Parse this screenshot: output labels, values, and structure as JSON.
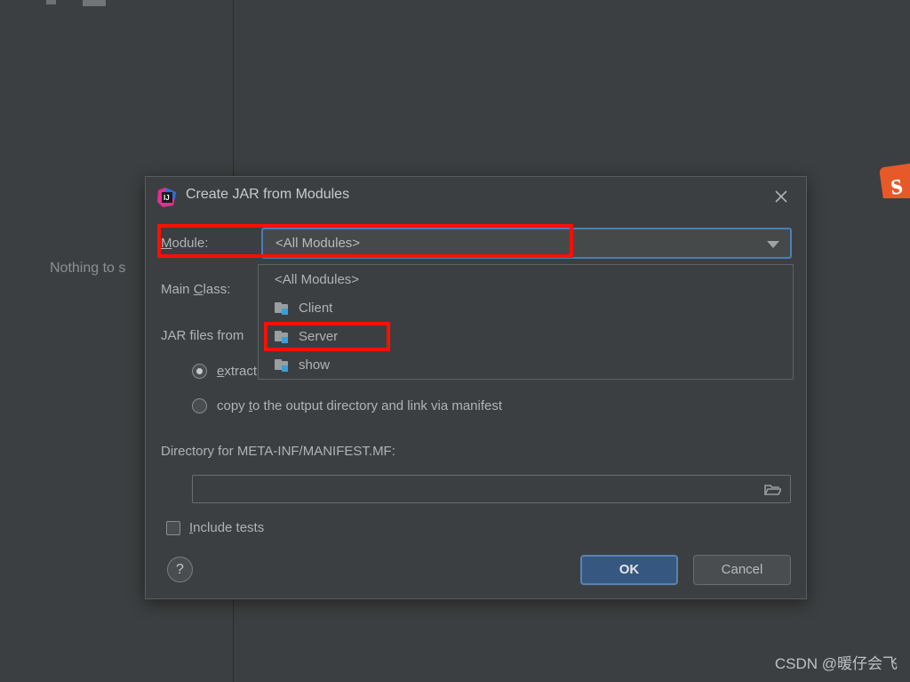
{
  "background": {
    "empty_message": "Nothing to s",
    "watermark": "CSDN @暖仔会飞",
    "side_icon": "sublime-orange-icon",
    "side_icon_glyph": "s"
  },
  "dialog": {
    "title": "Create JAR from Modules",
    "app_icon": "intellij-idea-icon",
    "close_icon": "close-icon",
    "fields": {
      "module_label": "Module:",
      "module_value": "<All Modules>",
      "module_dropdown_icon": "chevron-down-icon",
      "main_class_label": "Main Class:",
      "main_class_value": "",
      "jar_files_label": "JAR files from",
      "manifest_label": "Directory for META-INF/MANIFEST.MF:",
      "manifest_value": "",
      "manifest_browse_icon": "folder-icon"
    },
    "radios": [
      {
        "label": "extract to the target JAR",
        "checked": true
      },
      {
        "label": "copy to the output directory and link via manifest",
        "checked": false
      }
    ],
    "checkbox": {
      "label": "Include tests",
      "checked": false
    },
    "footer": {
      "help_label": "?",
      "ok_label": "OK",
      "cancel_label": "Cancel"
    }
  },
  "dropdown": {
    "items": [
      {
        "label": "<All Modules>",
        "has_icon": false
      },
      {
        "label": "Client",
        "has_icon": true
      },
      {
        "label": "Server",
        "has_icon": true
      },
      {
        "label": "show",
        "has_icon": true
      }
    ]
  },
  "annotations": {
    "accent_color": "#ff0f00",
    "module_row": "module-row-highlight",
    "server_item": "server-item-highlight"
  },
  "colors": {
    "dialog_bg": "#3c3f41",
    "focus_blue": "#4a7fb5",
    "ok_blue": "#365880",
    "module_badge": "#3a9fd8"
  }
}
